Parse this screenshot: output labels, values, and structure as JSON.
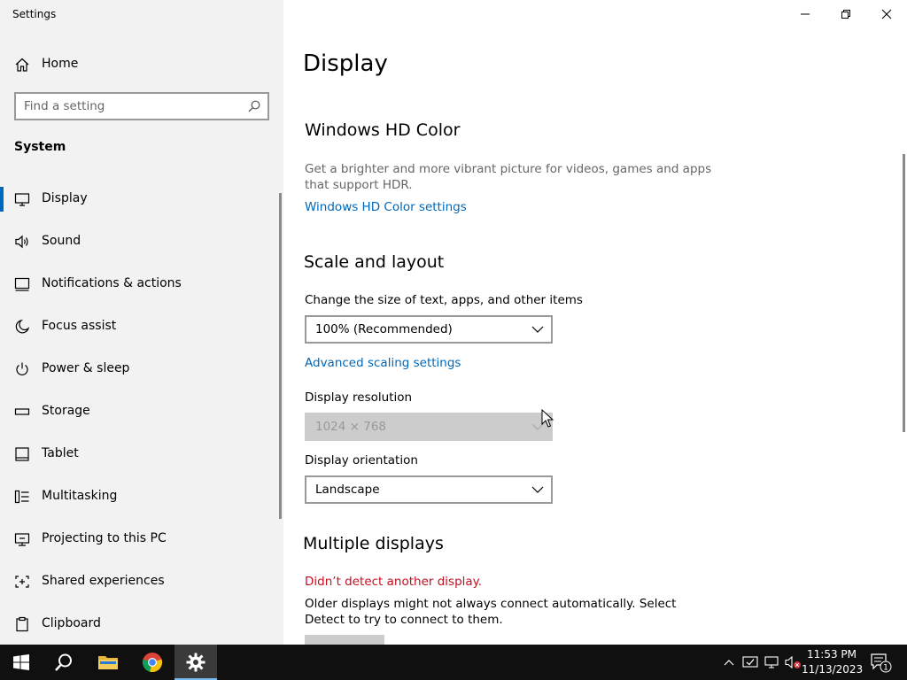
{
  "window": {
    "title": "Settings"
  },
  "sidebar": {
    "home_label": "Home",
    "search_placeholder": "Find a setting",
    "section": "System",
    "items": [
      {
        "label": "Display",
        "icon": "monitor-icon",
        "active": true
      },
      {
        "label": "Sound",
        "icon": "speaker-icon"
      },
      {
        "label": "Notifications & actions",
        "icon": "notifications-icon"
      },
      {
        "label": "Focus assist",
        "icon": "moon-icon"
      },
      {
        "label": "Power & sleep",
        "icon": "power-icon"
      },
      {
        "label": "Storage",
        "icon": "storage-icon"
      },
      {
        "label": "Tablet",
        "icon": "tablet-icon"
      },
      {
        "label": "Multitasking",
        "icon": "multitasking-icon"
      },
      {
        "label": "Projecting to this PC",
        "icon": "projecting-icon"
      },
      {
        "label": "Shared experiences",
        "icon": "shared-experiences-icon"
      },
      {
        "label": "Clipboard",
        "icon": "clipboard-icon"
      }
    ]
  },
  "main": {
    "title": "Display",
    "hdr": {
      "heading": "Windows HD Color",
      "description": "Get a brighter and more vibrant picture for videos, games and apps that support HDR.",
      "link": "Windows HD Color settings"
    },
    "scale": {
      "heading": "Scale and layout",
      "size_label": "Change the size of text, apps, and other items",
      "size_value": "100% (Recommended)",
      "advanced_link": "Advanced scaling settings",
      "resolution_label": "Display resolution",
      "resolution_value": "1024 × 768",
      "orientation_label": "Display orientation",
      "orientation_value": "Landscape"
    },
    "multiple": {
      "heading": "Multiple displays",
      "warning": "Didn’t detect another display.",
      "description": "Older displays might not always connect automatically. Select Detect to try to connect to them."
    }
  },
  "taskbar": {
    "time": "11:53 PM",
    "date": "11/13/2023",
    "notification_count": "1"
  },
  "colors": {
    "accent": "#0067c0",
    "link": "#0067b8",
    "warning": "#c50f1f",
    "sidebar_bg": "#f2f2f2",
    "taskbar_bg": "#101010"
  }
}
